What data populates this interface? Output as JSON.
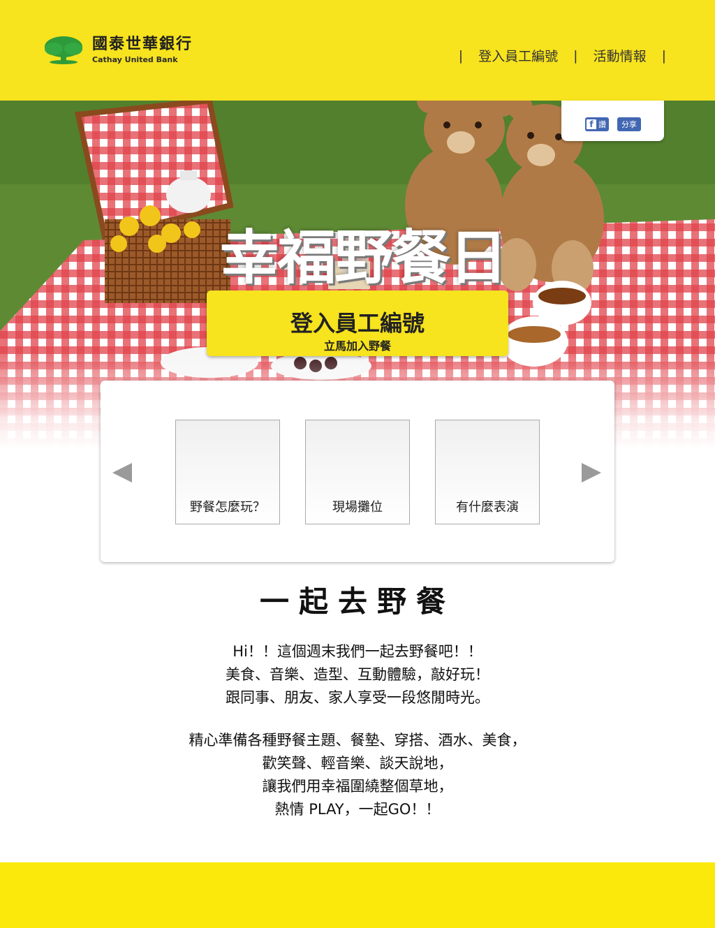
{
  "header": {
    "logo_cn": "國泰世華銀行",
    "logo_en": "Cathay United Bank",
    "nav": [
      {
        "label": "登入員工編號"
      },
      {
        "label": "活動情報"
      }
    ],
    "separator": "|"
  },
  "social": {
    "like_label": "讚",
    "share_label": "分享"
  },
  "hero": {
    "title": "幸福野餐日",
    "cta_label": "登入員工編號",
    "cta_sub": "立馬加入野餐"
  },
  "carousel": {
    "items": [
      {
        "label": "野餐怎麼玩？"
      },
      {
        "label": "現場攤位"
      },
      {
        "label": "有什麼表演"
      }
    ]
  },
  "main": {
    "title": "一起去野餐",
    "para1": [
      "Hi！！這個週末我們一起去野餐吧！！",
      "美食、音樂、造型、互動體驗，敲好玩！",
      "跟同事、朋友、家人享受一段悠閒時光。"
    ],
    "para2": [
      "精心準備各種野餐主題、餐墊、穿搭、酒水、美食，",
      "歡笑聲、輕音樂、談天說地，",
      "讓我們用幸福圍繞整個草地，",
      "熱情 PLAY，一起GO！！"
    ]
  },
  "colors": {
    "brand_yellow": "#f7e31e",
    "logo_green": "#2e9b3a",
    "fb_blue": "#4267b2"
  }
}
